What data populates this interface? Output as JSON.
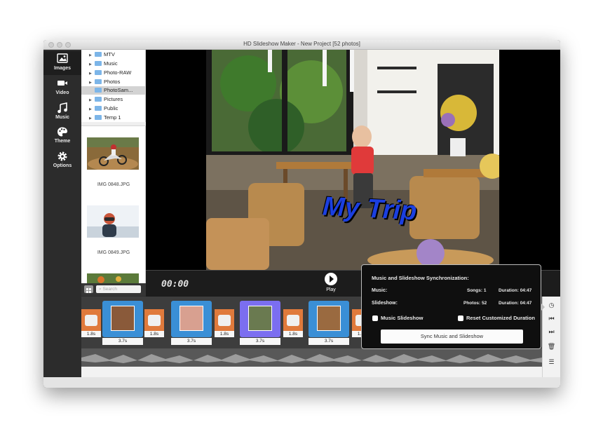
{
  "window": {
    "title": "HD Slideshow Maker - New Project [52 photos]"
  },
  "sidebar": {
    "items": [
      {
        "label": "Images",
        "icon": "image-icon"
      },
      {
        "label": "Video",
        "icon": "video-camera-icon"
      },
      {
        "label": "Music",
        "icon": "music-note-icon"
      },
      {
        "label": "Theme",
        "icon": "palette-icon"
      },
      {
        "label": "Options",
        "icon": "gear-icon"
      }
    ]
  },
  "tree": {
    "items": [
      "MTV",
      "Music",
      "Photo-RAW",
      "Photos",
      "PhotoSam...",
      "Pictures",
      "Public",
      "Temp 1"
    ],
    "selected": "PhotoSam..."
  },
  "thumbs": [
    {
      "name": "IMG 0848.JPG"
    },
    {
      "name": "IMG 0849.JPG"
    }
  ],
  "search": {
    "placeholder": "Search"
  },
  "preview": {
    "overlay_text": "My Trip"
  },
  "player": {
    "timecode": "00:00",
    "play_label": "Play"
  },
  "timeline": {
    "transition_duration": "1.8s",
    "slide_duration": "3.7s"
  },
  "sync_popup": {
    "title": "Music and Slideshow Synchronization:",
    "music_label": "Music:",
    "music_songs": "Songs: 1",
    "music_duration": "Duration: 04:47",
    "slideshow_label": "Slideshow:",
    "slideshow_photos": "Photos: 52",
    "slideshow_duration": "Duration: 04:47",
    "music_slideshow_checkbox": "Music Slideshow",
    "reset_duration_checkbox": "Reset Customized Duration",
    "sync_button": "Sync Music and Slideshow"
  },
  "colors": {
    "accent_blue": "#3a8fd6",
    "transition_orange": "#e07a3c",
    "selected_slide": "#7b6ef0",
    "overlay_text": "#1b3fe0"
  }
}
